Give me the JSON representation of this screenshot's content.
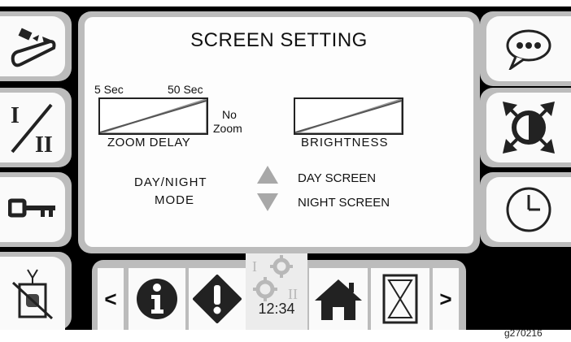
{
  "screen": {
    "title": "SCREEN SETTING",
    "zoom_delay": {
      "min_label": "5 Sec",
      "max_label": "50 Sec",
      "no_zoom_label_1": "No",
      "no_zoom_label_2": "Zoom",
      "label": "ZOOM DELAY"
    },
    "brightness": {
      "label": "BRIGHTNESS"
    },
    "day_night": {
      "label_1": "DAY/NIGHT",
      "label_2": "MODE",
      "day_option": "DAY SCREEN",
      "night_option": "NIGHT SCREEN"
    }
  },
  "bottom_bar": {
    "prev_label": "<",
    "next_label": ">",
    "clock": "12:34"
  },
  "figure_tag": "g270216",
  "icons": {
    "left": [
      "tool-icon",
      "one-two-switch-icon",
      "key-icon",
      "no-signal-icon"
    ],
    "right": [
      "speech-bubble-icon",
      "contrast-expand-icon",
      "clock-icon"
    ],
    "bottom": [
      "info-icon",
      "warning-icon",
      "settings-gears-icon",
      "home-icon",
      "hourglass-icon"
    ]
  },
  "colors": {
    "bezel": "#000000",
    "button": "#fafafa",
    "frame": "#bcbcbc",
    "arrow": "#aaaaaa"
  }
}
